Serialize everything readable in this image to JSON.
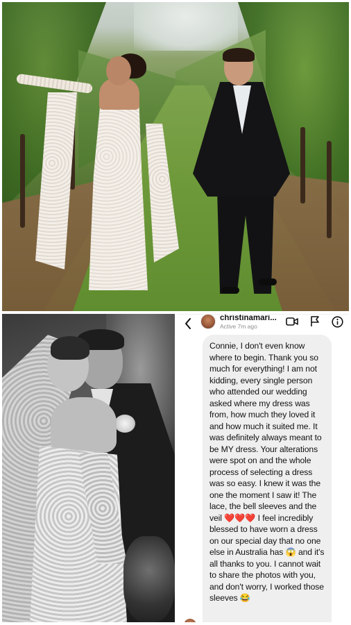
{
  "dm": {
    "username": "christinamari...",
    "status": "Active 7m ago",
    "message": "Connie, I don't even know where to begin. Thank you so much for everything! I am not kidding, every single person who attended our wedding asked where my dress was from, how much they loved it and how much it suited me. It was definitely always meant to be MY dress. Your alterations were spot on and the whole process of selecting a dress was so easy. I knew it was the one the moment I saw it! The lace, the bell sleeves and the veil ❤️❤️❤️ I feel incredibly blessed to have worn a dress on our special day that no one else in Australia has 😱 and it's all thanks to you. I cannot wait to share the photos with you, and don't worry, I worked those sleeves 😂",
    "icons": [
      "back-arrow-icon",
      "video-call-icon",
      "flag-icon",
      "info-icon"
    ]
  },
  "colors": {
    "bubble": "#efefef",
    "text": "#111111",
    "muted": "#8e8e8e"
  }
}
